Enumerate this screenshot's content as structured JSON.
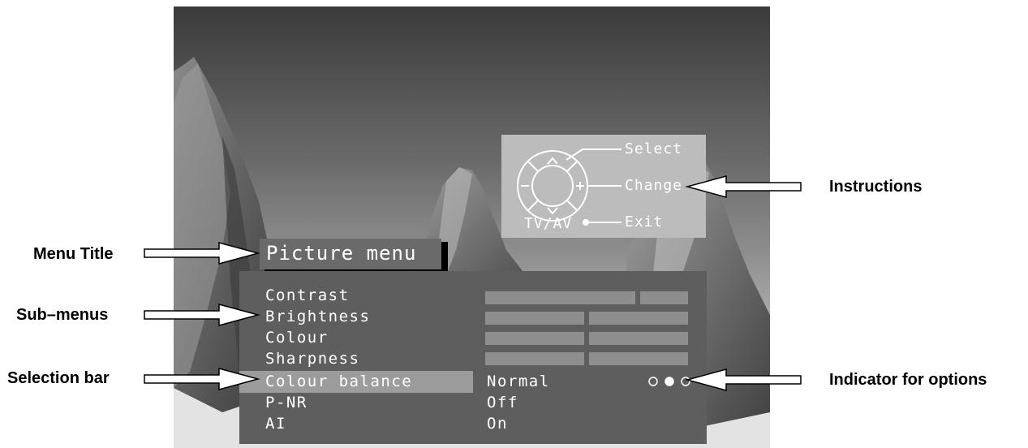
{
  "instructions": {
    "select": "Select",
    "change": "Change",
    "exit": "Exit",
    "tv_av": "TV/AV"
  },
  "menu": {
    "title": "Picture menu",
    "items": [
      {
        "label": "Contrast",
        "control": "slider",
        "level_percent": 75
      },
      {
        "label": "Brightness",
        "control": "slider",
        "level_percent": 50
      },
      {
        "label": "Colour",
        "control": "slider",
        "level_percent": 50
      },
      {
        "label": "Sharpness",
        "control": "slider",
        "level_percent": 50
      },
      {
        "label": "Colour balance",
        "control": "value",
        "value": "Normal",
        "selected": true,
        "options_count": 3,
        "active_option_index": 1
      },
      {
        "label": "P-NR",
        "control": "value",
        "value": "Off"
      },
      {
        "label": "AI",
        "control": "value",
        "value": "On"
      }
    ]
  },
  "callouts": {
    "menu_title": "Menu Title",
    "sub_menus": "Sub–menus",
    "selection_bar": "Selection bar",
    "instructions": "Instructions",
    "indicator": "Indicator for options"
  },
  "icons": [
    "navigation-pad-icon",
    "arrow-icon",
    "option-dot-icon"
  ],
  "colors": {
    "menu_panel": "#5e5e5e",
    "selection_bar": "#9c9c9c",
    "instructions_box": "#bcbcbc",
    "slider": "#8e8e8e"
  }
}
